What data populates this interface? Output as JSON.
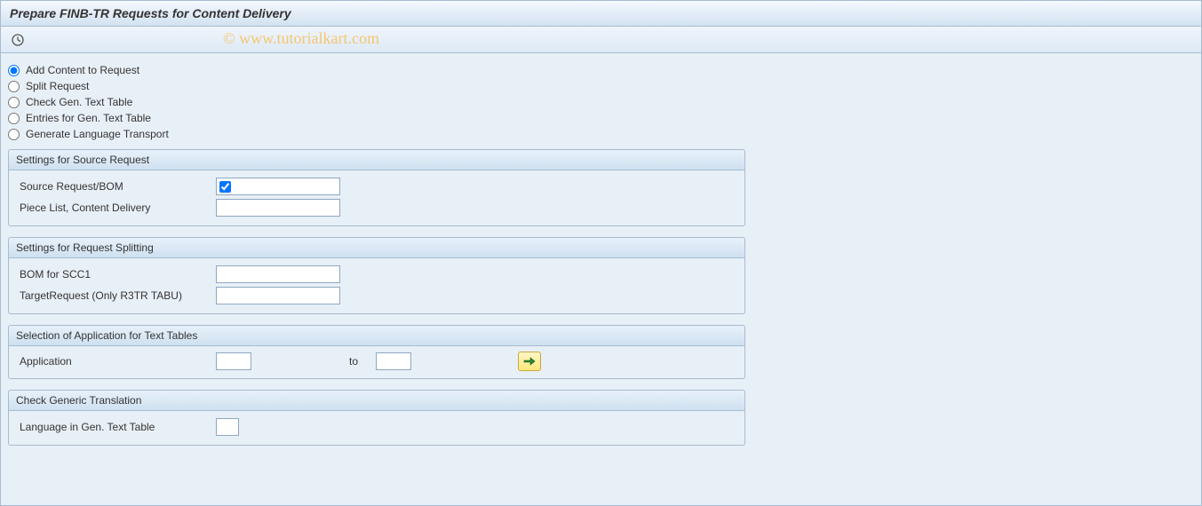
{
  "title": "Prepare FINB-TR Requests for Content Delivery",
  "watermark": "© www.tutorialkart.com",
  "radio_options": {
    "add_content": "Add Content to Request",
    "split_request": "Split Request",
    "check_gen_text": "Check Gen. Text Table",
    "entries_gen_text": "Entries for Gen. Text Table",
    "gen_lang_transport": "Generate Language Transport"
  },
  "groups": {
    "source": {
      "title": "Settings for Source Request",
      "source_request_label": "Source Request/BOM",
      "source_request_checked": true,
      "piece_list_label": "Piece List, Content Delivery",
      "piece_list_value": ""
    },
    "split": {
      "title": "Settings for Request Splitting",
      "bom_scc1_label": "BOM for SCC1",
      "bom_scc1_value": "",
      "target_request_label": "TargetRequest (Only R3TR TABU)",
      "target_request_value": ""
    },
    "app_select": {
      "title": "Selection of Application for Text Tables",
      "application_label": "Application",
      "from_value": "",
      "to_label": "to",
      "to_value": ""
    },
    "check_trans": {
      "title": "Check Generic Translation",
      "language_label": "Language in Gen. Text Table",
      "language_value": ""
    }
  }
}
